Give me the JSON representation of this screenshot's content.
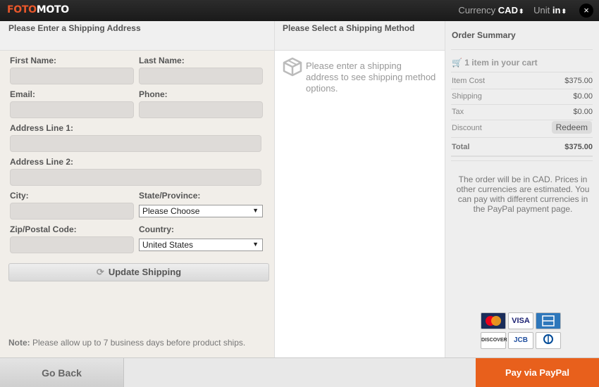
{
  "header": {
    "logo_part1": "FOTO",
    "logo_part2": "MOTO",
    "currency_label": "Currency",
    "currency_value": "CAD",
    "unit_label": "Unit",
    "unit_value": "in",
    "close_symbol": "×"
  },
  "address": {
    "heading": "Please Enter a Shipping Address",
    "first_name_label": "First Name:",
    "last_name_label": "Last Name:",
    "email_label": "Email:",
    "phone_label": "Phone:",
    "address1_label": "Address Line 1:",
    "address2_label": "Address Line 2:",
    "city_label": "City:",
    "state_label": "State/Province:",
    "state_value": "Please Choose",
    "zip_label": "Zip/Postal Code:",
    "country_label": "Country:",
    "country_value": "United States",
    "update_button": "Update Shipping",
    "note_prefix": "Note:",
    "note_text": "Please allow up to 7 business days before product ships."
  },
  "method": {
    "heading": "Please Select a Shipping Method",
    "message": "Please enter a shipping address to see shipping method options."
  },
  "summary": {
    "title": "Order Summary",
    "cart_text": "1 item in your cart",
    "item_cost_label": "Item Cost",
    "item_cost_value": "$375.00",
    "shipping_label": "Shipping",
    "shipping_value": "$0.00",
    "tax_label": "Tax",
    "tax_value": "$0.00",
    "discount_label": "Discount",
    "redeem_button": "Redeem",
    "total_label": "Total",
    "total_value": "$375.00",
    "note": "The order will be in CAD. Prices in other currencies are estimated. You can pay with different currencies in the PayPal payment page.",
    "cards": [
      "MasterCard",
      "VISA",
      "AMEX",
      "DISCOVER",
      "JCB",
      "Diners Club"
    ]
  },
  "footer": {
    "go_back": "Go Back",
    "pay_button": "Pay via PayPal"
  },
  "colors": {
    "accent": "#e8601c",
    "topbar": "#1f1f1f"
  }
}
